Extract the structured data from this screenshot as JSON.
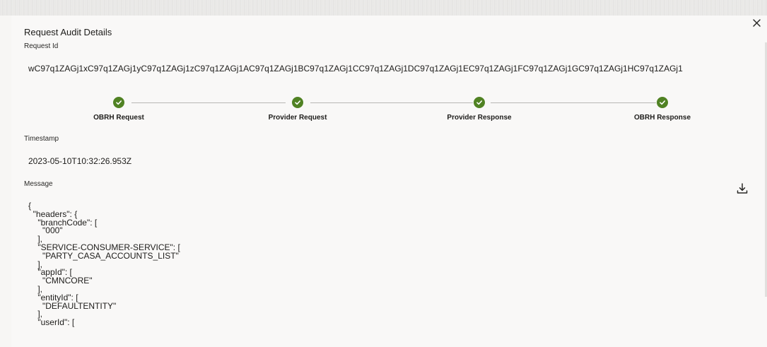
{
  "dialog": {
    "title": "Request Audit Details"
  },
  "request": {
    "id_label": "Request Id",
    "id_value": "wC97q1ZAGj1xC97q1ZAGj1yC97q1ZAGj1zC97q1ZAGj1AC97q1ZAGj1BC97q1ZAGj1CC97q1ZAGj1DC97q1ZAGj1EC97q1ZAGj1FC97q1ZAGj1GC97q1ZAGj1HC97q1ZAGj1"
  },
  "steps": [
    {
      "label": "OBRH Request",
      "status": "complete"
    },
    {
      "label": "Provider Request",
      "status": "complete"
    },
    {
      "label": "Provider Response",
      "status": "complete"
    },
    {
      "label": "OBRH Response",
      "status": "complete"
    }
  ],
  "timestamp": {
    "label": "Timestamp",
    "value": "2023-05-10T10:32:26.953Z"
  },
  "message": {
    "label": "Message",
    "lines": [
      "{",
      "  \"headers\": {",
      "    \"branchCode\": [",
      "      \"000\"",
      "    ],",
      "    \"SERVICE-CONSUMER-SERVICE\": [",
      "      \"PARTY_CASA_ACCOUNTS_LIST\"",
      "    ],",
      "    \"appId\": [",
      "      \"CMNCORE\"",
      "    ],",
      "    \"entityId\": [",
      "      \"DEFAULTENTITY\"",
      "    ],",
      "    \"userId\": ["
    ]
  },
  "icons": {
    "close": "close-icon",
    "download": "download-icon",
    "step_complete": "check-icon"
  },
  "colors": {
    "step_complete": "#508223",
    "background": "#f9f8f7"
  }
}
